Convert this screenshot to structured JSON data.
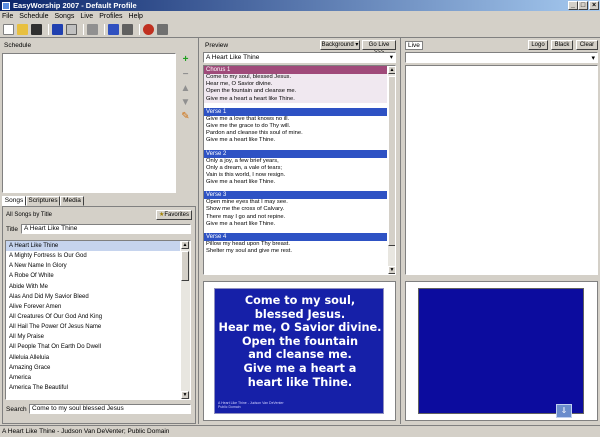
{
  "window": {
    "title": "EasyWorship 2007 - Default Profile"
  },
  "menu": [
    "File",
    "Schedule",
    "Songs",
    "Live",
    "Profiles",
    "Help"
  ],
  "schedule": {
    "label": "Schedule"
  },
  "tabs": [
    "Songs",
    "Scriptures",
    "Media"
  ],
  "songs_panel": {
    "all_songs_label": "All Songs by Title",
    "favorites_label": "Favorites",
    "title_label": "Title",
    "title_value": "A Heart Like Thine",
    "search_label": "Search",
    "search_value": "Come to my soul blessed Jesus",
    "items": [
      "A Heart Like Thine",
      "A Mighty Fortress Is Our God",
      "A New Name In Glory",
      "A Robe Of White",
      "Abide With Me",
      "Alas And Did My Savior Bleed",
      "Alive Forever Amen",
      "All Creatures Of Our God And King",
      "All Hail The Power Of Jesus Name",
      "All My Praise",
      "All People That On Earth Do Dwell",
      "Alleluia Alleluia",
      "Amazing Grace",
      "America",
      "America The Beautiful"
    ]
  },
  "preview": {
    "label": "Preview",
    "background_label": "Background",
    "golive_label": "Go Live >>>",
    "song_title": "A Heart Like Thine",
    "sections": [
      {
        "name": "Chorus 1",
        "lines": [
          "Come to my soul, blessed Jesus.",
          "Hear me, O Savior divine.",
          "Open the fountain and cleanse me.",
          "Give me a heart a heart like Thine."
        ]
      },
      {
        "name": "Verse 1",
        "lines": [
          "Give me a love that knows no ill.",
          "Give me the grace to do Thy will.",
          "Pardon and cleanse this soul of mine.",
          "Give me a heart like Thine."
        ]
      },
      {
        "name": "Verse 2",
        "lines": [
          "Only a joy, a few brief years,",
          "Only a dream, a vale of tears;",
          "Vain is this world, I now resign.",
          "Give me a heart like Thine."
        ]
      },
      {
        "name": "Verse 3",
        "lines": [
          "Open mine eyes that I may see.",
          "Show me the cross of Calvary.",
          "There may I go and not repine.",
          "Give me a heart like Thine."
        ]
      },
      {
        "name": "Verse 4",
        "lines": [
          "Pillow my head upon Thy breast.",
          "Shelter my soul and give me rest."
        ]
      }
    ],
    "slide_lines": [
      "Come to my soul,",
      "blessed Jesus.",
      "Hear me, O Savior divine.",
      "Open the fountain",
      "and cleanse me.",
      "Give me a heart a",
      "heart like Thine."
    ],
    "slide_footer": [
      "A Heart Like Thine - Judson Van DeVenter",
      "Public Domain"
    ]
  },
  "live": {
    "label": "Live",
    "logo_label": "Logo",
    "black_label": "Black",
    "clear_label": "Clear"
  },
  "statusbar": {
    "text": "A Heart Like Thine - Judson Van DeVenter; Public Domain"
  },
  "colors": {
    "chorus_header": "#a04a7a",
    "verse_header": "#2e52c4",
    "slide_bg": "#1620a8",
    "live_bg": "#0c0c9e"
  }
}
